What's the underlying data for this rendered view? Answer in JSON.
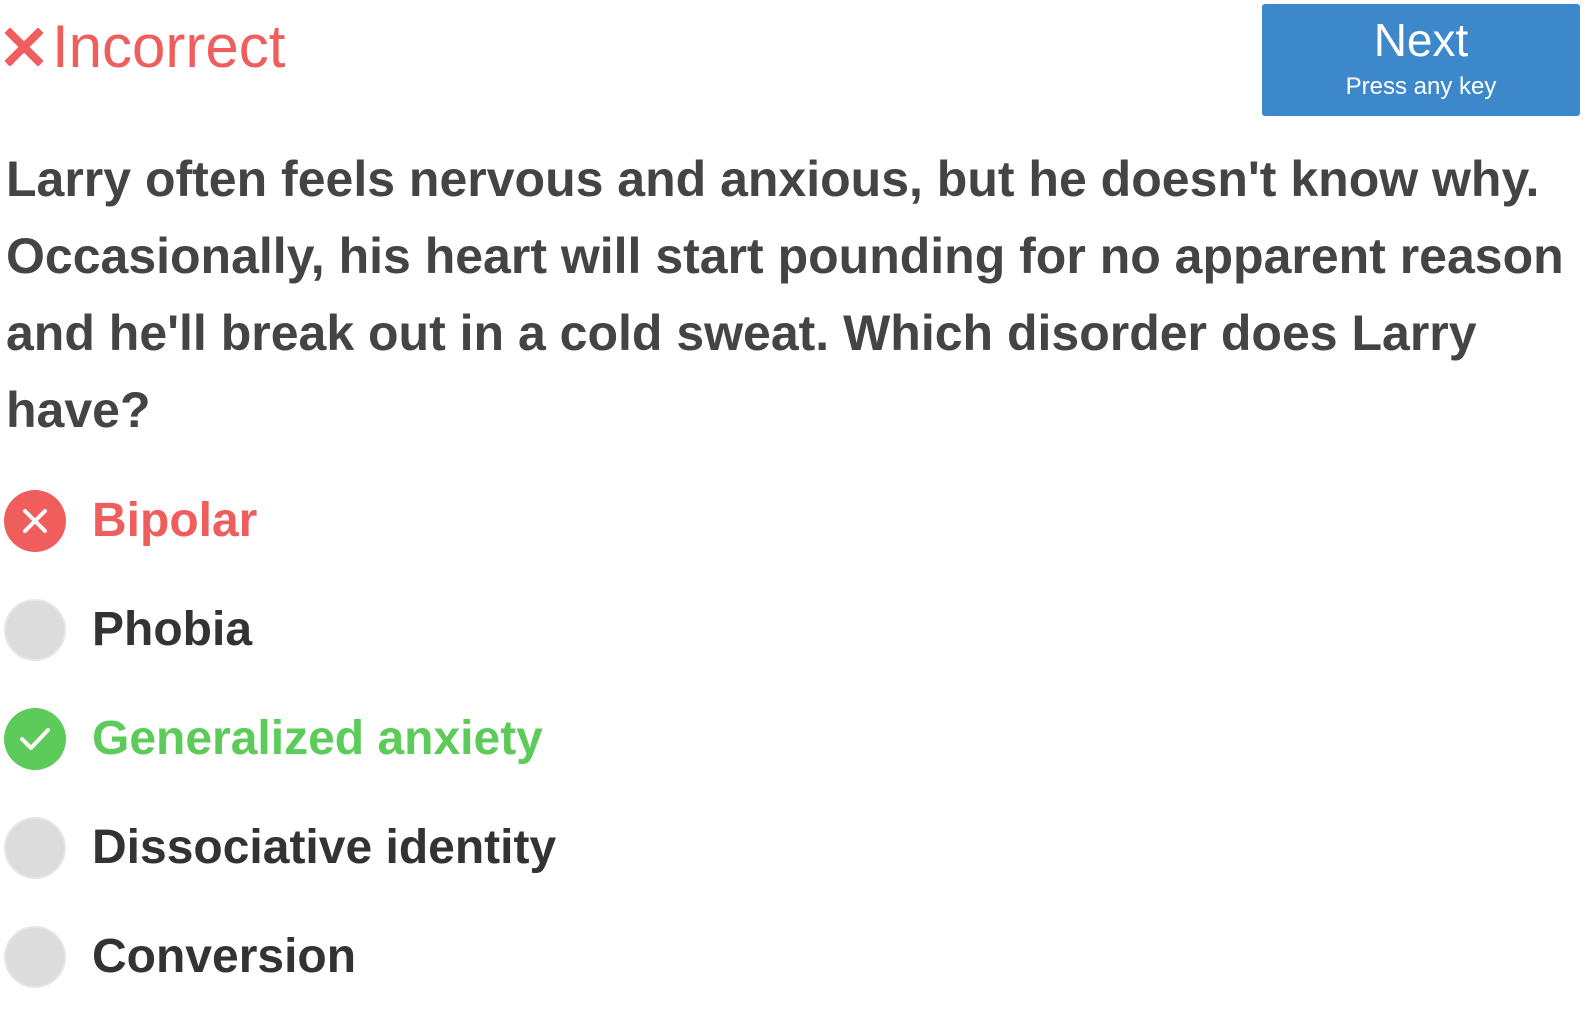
{
  "status": {
    "label": "Incorrect",
    "icon": "close-icon",
    "color": "#ef5d5d"
  },
  "next_button": {
    "label": "Next",
    "hint": "Press any key",
    "color": "#3d88ca"
  },
  "question": {
    "text": "Larry often feels nervous and anxious, but he doesn't know why. Occasionally, his heart will start pounding for no apparent reason and he'll break out in a cold sweat. Which disorder does Larry have?"
  },
  "options": [
    {
      "label": "Bipolar",
      "state": "wrong",
      "icon": "close-icon",
      "color": "#ef5d5d"
    },
    {
      "label": "Phobia",
      "state": "neutral",
      "icon": "radio-empty-icon",
      "color": "#dcdcdc"
    },
    {
      "label": "Generalized anxiety",
      "state": "correct",
      "icon": "check-icon",
      "color": "#5ccb5a"
    },
    {
      "label": "Dissociative identity",
      "state": "neutral",
      "icon": "radio-empty-icon",
      "color": "#dcdcdc"
    },
    {
      "label": "Conversion",
      "state": "neutral",
      "icon": "radio-empty-icon",
      "color": "#dcdcdc"
    }
  ]
}
